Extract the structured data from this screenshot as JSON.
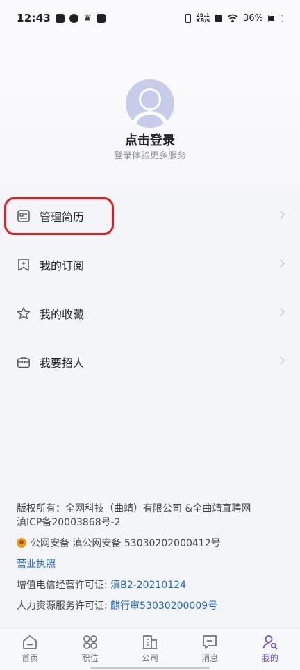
{
  "status": {
    "time": "12:43",
    "net_speed_top": "25.1",
    "net_speed_bottom": "KB/s",
    "battery": "36%"
  },
  "profile": {
    "login_title": "点击登录",
    "login_subtitle": "登录体验更多服务"
  },
  "menu": [
    {
      "label": "管理简历",
      "icon": "resume-icon"
    },
    {
      "label": "我的订阅",
      "icon": "bookmark-plus-icon"
    },
    {
      "label": "我的收藏",
      "icon": "star-icon"
    },
    {
      "label": "我要招人",
      "icon": "briefcase-icon"
    }
  ],
  "footer": {
    "copyright_line1": "版权所有：全网科技（曲靖）有限公司 &全曲靖直聘网",
    "copyright_line2": "滇ICP备20003868号-2",
    "police_record": "公网安备 滇公网安备 53030202000412号",
    "business_license": "营业执照",
    "telecom_label": "增值电信经营许可证: ",
    "telecom_value": "滇B2-20210124",
    "hr_label": "人力资源服务许可证: ",
    "hr_value": "麒行审53030200009号"
  },
  "tabs": [
    {
      "label": "首页",
      "icon": "home-icon"
    },
    {
      "label": "职位",
      "icon": "grid-icon"
    },
    {
      "label": "公司",
      "icon": "building-icon"
    },
    {
      "label": "消息",
      "icon": "message-icon"
    },
    {
      "label": "我的",
      "icon": "profile-search-icon",
      "active": true
    }
  ],
  "colors": {
    "accent": "#6d4dd8",
    "link": "#1f66c9",
    "highlight": "#e21d1d"
  }
}
